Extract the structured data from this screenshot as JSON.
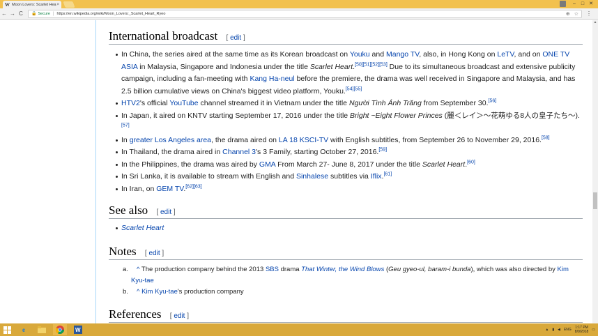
{
  "browser": {
    "tab_title": "Moon Lovers: Scarlet Hea",
    "tab_close": "×",
    "favicon": "W",
    "secure_label": "Secure",
    "url": "https://en.wikipedia.org/wiki/Moon_Lovers:_Scarlet_Heart_Ryeo",
    "back": "←",
    "forward": "→",
    "reload": "C"
  },
  "sections": {
    "intl": {
      "heading": "International broadcast",
      "edit": "edit",
      "items": {
        "china": {
          "t1": "In China, the series aired at the same time as its Korean broadcast on ",
          "youku": "Youku",
          "t2": " and ",
          "mango": "Mango TV",
          "t3": ", also, in Hong Kong on ",
          "letv": "LeTV",
          "t4": ", and on ",
          "one": "ONE TV ASIA",
          "t5": " in Malaysia, Singapore and Indonesia under the title ",
          "title": "Scarlet Heart",
          "t6": ".",
          "refs1": "[50][51][52][53]",
          "t7": " Due to its simultaneous broadcast and extensive publicity campaign, including a fan-meeting with ",
          "kang": "Kang Ha-neul",
          "t8": " before the premiere, the drama was well received in Singapore and Malaysia, and has 2.5 billion cumulative views on China's biggest video platform, Youku.",
          "refs2": "[54][55]"
        },
        "vietnam": {
          "htv": "HTV2",
          "t1": "'s official ",
          "yt": "YouTube",
          "t2": " channel streamed it in Vietnam under the title ",
          "title": "Người Tình Ánh Trăng",
          "t3": " from September 30.",
          "refs": "[56]"
        },
        "japan": {
          "t1": "In Japan, it aired on KNTV starting September 17, 2016 under the title ",
          "title": "Bright ~Eight Flower Princes",
          "t2": " (麗＜レイ＞～花萌ゆる8人の皇子たち～).",
          "refs": "[57]"
        },
        "la": {
          "t1": "In ",
          "gla": "greater Los Angeles area",
          "t2": ", the drama aired on ",
          "ksci": "LA 18 KSCI-TV",
          "t3": " with English subtitles, from September 26 to November 29, 2016.",
          "refs": "[58]"
        },
        "thailand": {
          "t1": "In Thailand, the drama aired in ",
          "ch3": "Channel 3",
          "t2": "'s 3 Family, starting October 27, 2016.",
          "refs": "[59]"
        },
        "philippines": {
          "t1": "In the Philippines, the drama was aired by ",
          "gma": "GMA",
          "t2": " From March 27- June 8, 2017 under the title ",
          "title": "Scarlet Heart",
          "t3": ".",
          "refs": "[60]"
        },
        "srilanka": {
          "t1": "In Sri Lanka, it is available to stream with English and ",
          "sinhalese": "Sinhalese",
          "t2": " subtitles via ",
          "iflix": "Iflix",
          "t3": ".",
          "refs": "[61]"
        },
        "iran": {
          "t1": "In Iran, on ",
          "gem": "GEM TV",
          "t2": ".",
          "refs": "[62][63]"
        }
      }
    },
    "seealso": {
      "heading": "See also",
      "edit": "edit",
      "item": "Scarlet Heart"
    },
    "notes": {
      "heading": "Notes",
      "edit": "edit",
      "a": {
        "marker": "a.",
        "caret": "^",
        "t1": " The production company behind the 2013 ",
        "sbs": "SBS",
        "t2": " drama ",
        "title": "That Winter, the Wind Blows",
        "t3": " (",
        "rom": "Geu gyeo-ul, baram-i bunda",
        "t4": "), which was also directed by ",
        "kim": "Kim Kyu-tae"
      },
      "b": {
        "marker": "b.",
        "caret": "^",
        "kim": "Kim Kyu-tae",
        "t1": "'s production company"
      }
    },
    "references": {
      "heading": "References",
      "edit": "edit"
    }
  },
  "taskbar": {
    "time": "1:17 PM",
    "date": "8/9/2018",
    "lang": "ENG"
  }
}
